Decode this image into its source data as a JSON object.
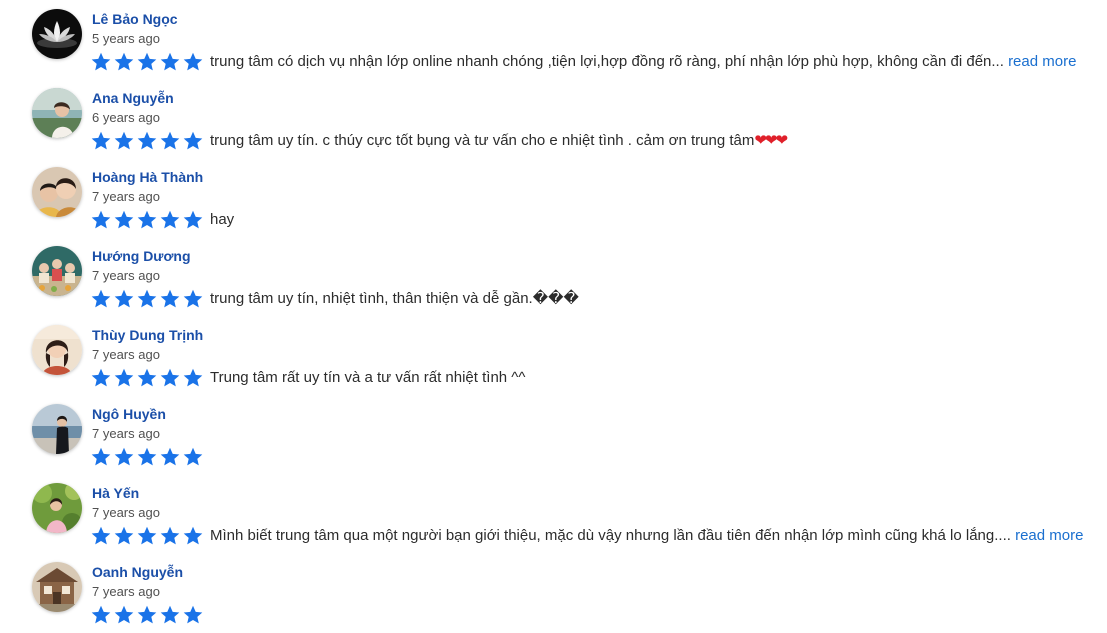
{
  "colors": {
    "name": "#1b4fa8",
    "star": "#1a73e8",
    "read_more": "#1a6fcf",
    "heart": "#e0202a"
  },
  "reviews": [
    {
      "name": "Lê Bảo Ngọc",
      "time": "5 years ago",
      "rating": 5,
      "text": "trung tâm có dịch vụ nhận lớp online nhanh chóng ,tiện lợi,hợp đồng rõ ràng,  phí nhận lớp phù hợp, không cần đi đến...",
      "read_more": "read more",
      "avatar_icon": "lotus-avatar-icon"
    },
    {
      "name": "Ana Nguyễn",
      "time": "6 years ago",
      "rating": 5,
      "text": "trung tâm uy tín.  c thúy cực tốt bụng và tư vấn cho e nhiệt tình . cảm ơn trung tâm",
      "hearts": "❤❤❤",
      "avatar_icon": "person-avatar-icon"
    },
    {
      "name": "Hoàng Hà Thành",
      "time": "7 years ago",
      "rating": 5,
      "text": "hay",
      "avatar_icon": "couple-avatar-icon"
    },
    {
      "name": "Hướng Dương",
      "time": "7 years ago",
      "rating": 5,
      "text": "trung tâm uy tín,  nhiệt tình,  thân thiện và dễ gần.���",
      "avatar_icon": "group-avatar-icon"
    },
    {
      "name": "Thùy Dung Trịnh",
      "time": "7 years ago",
      "rating": 5,
      "text": "Trung tâm rất uy tín và a tư vấn rất nhiệt tình ^^",
      "avatar_icon": "person-avatar-icon"
    },
    {
      "name": "Ngô Huyền",
      "time": "7 years ago",
      "rating": 5,
      "text": "",
      "avatar_icon": "person-seaside-avatar-icon"
    },
    {
      "name": "Hà Yến",
      "time": "7 years ago",
      "rating": 5,
      "text": "Mình biết trung tâm qua một người bạn giới thiệu, mặc dù vậy nhưng lần đầu tiên đến nhận lớp mình cũng khá lo lắng....",
      "read_more": "read more",
      "avatar_icon": "person-garden-avatar-icon"
    },
    {
      "name": "Oanh Nguyễn",
      "time": "7 years ago",
      "rating": 5,
      "text": "",
      "avatar_icon": "house-avatar-icon"
    }
  ]
}
